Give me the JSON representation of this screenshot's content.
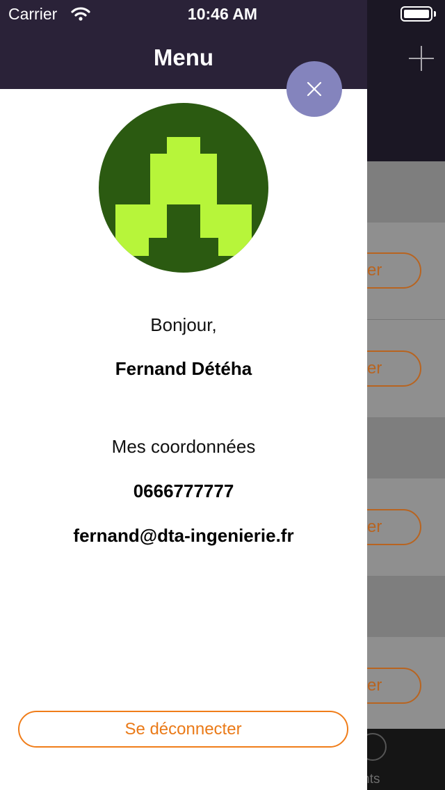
{
  "status_bar": {
    "carrier": "Carrier",
    "time": "10:46 AM"
  },
  "drawer": {
    "title": "Menu",
    "greeting": "Bonjour,",
    "user_name": "Fernand Détéha",
    "contact_title": "Mes coordonnées",
    "phone": "0666777777",
    "email": "fernand@dta-ingenierie.fr",
    "logout_label": "Se déconnecter"
  },
  "background": {
    "row_button_label_fragment": "er",
    "tab_label_fragment": "uents"
  },
  "colors": {
    "header": "#2a2238",
    "close_button": "#8484bd",
    "accent": "#f07d19",
    "avatar_bg": "#2b5a11",
    "avatar_fg": "#b7f53a"
  },
  "icons": [
    "wifi-icon",
    "battery-icon",
    "close-icon",
    "plus-icon",
    "avatar-identicon"
  ]
}
